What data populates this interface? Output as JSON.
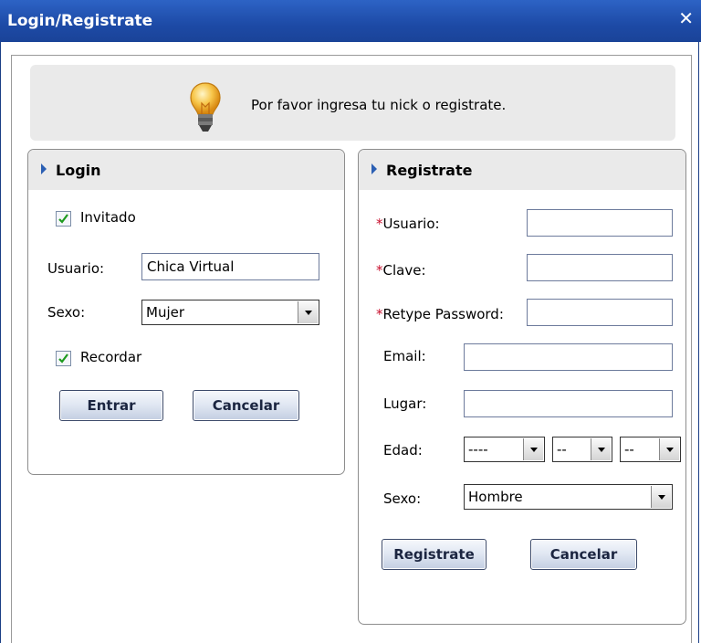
{
  "window": {
    "title": "Login/Registrate",
    "close_glyph": "✕"
  },
  "hint": {
    "icon": "lightbulb-icon",
    "text": "Por favor ingresa tu nick o registrate."
  },
  "login": {
    "title": "Login",
    "guest_label": "Invitado",
    "guest_checked": true,
    "user_label": "Usuario:",
    "user_value": "Chica Virtual",
    "sex_label": "Sexo:",
    "sex_value": "Mujer",
    "remember_label": "Recordar",
    "remember_checked": true,
    "enter_button": "Entrar",
    "cancel_button": "Cancelar"
  },
  "register": {
    "title": "Registrate",
    "required_mark": "*",
    "user_label": "Usuario:",
    "password_label": "Clave:",
    "retype_label": "Retype Password:",
    "email_label": "Email:",
    "place_label": "Lugar:",
    "age_label": "Edad:",
    "age_year_value": "----",
    "age_month_value": "--",
    "age_day_value": "--",
    "sex_label": "Sexo:",
    "sex_value": "Hombre",
    "register_button": "Registrate",
    "cancel_button": "Cancelar"
  },
  "colors": {
    "titlebar": "#1d4aa6",
    "required": "#c8102e",
    "accent": "#2b5fb3"
  }
}
